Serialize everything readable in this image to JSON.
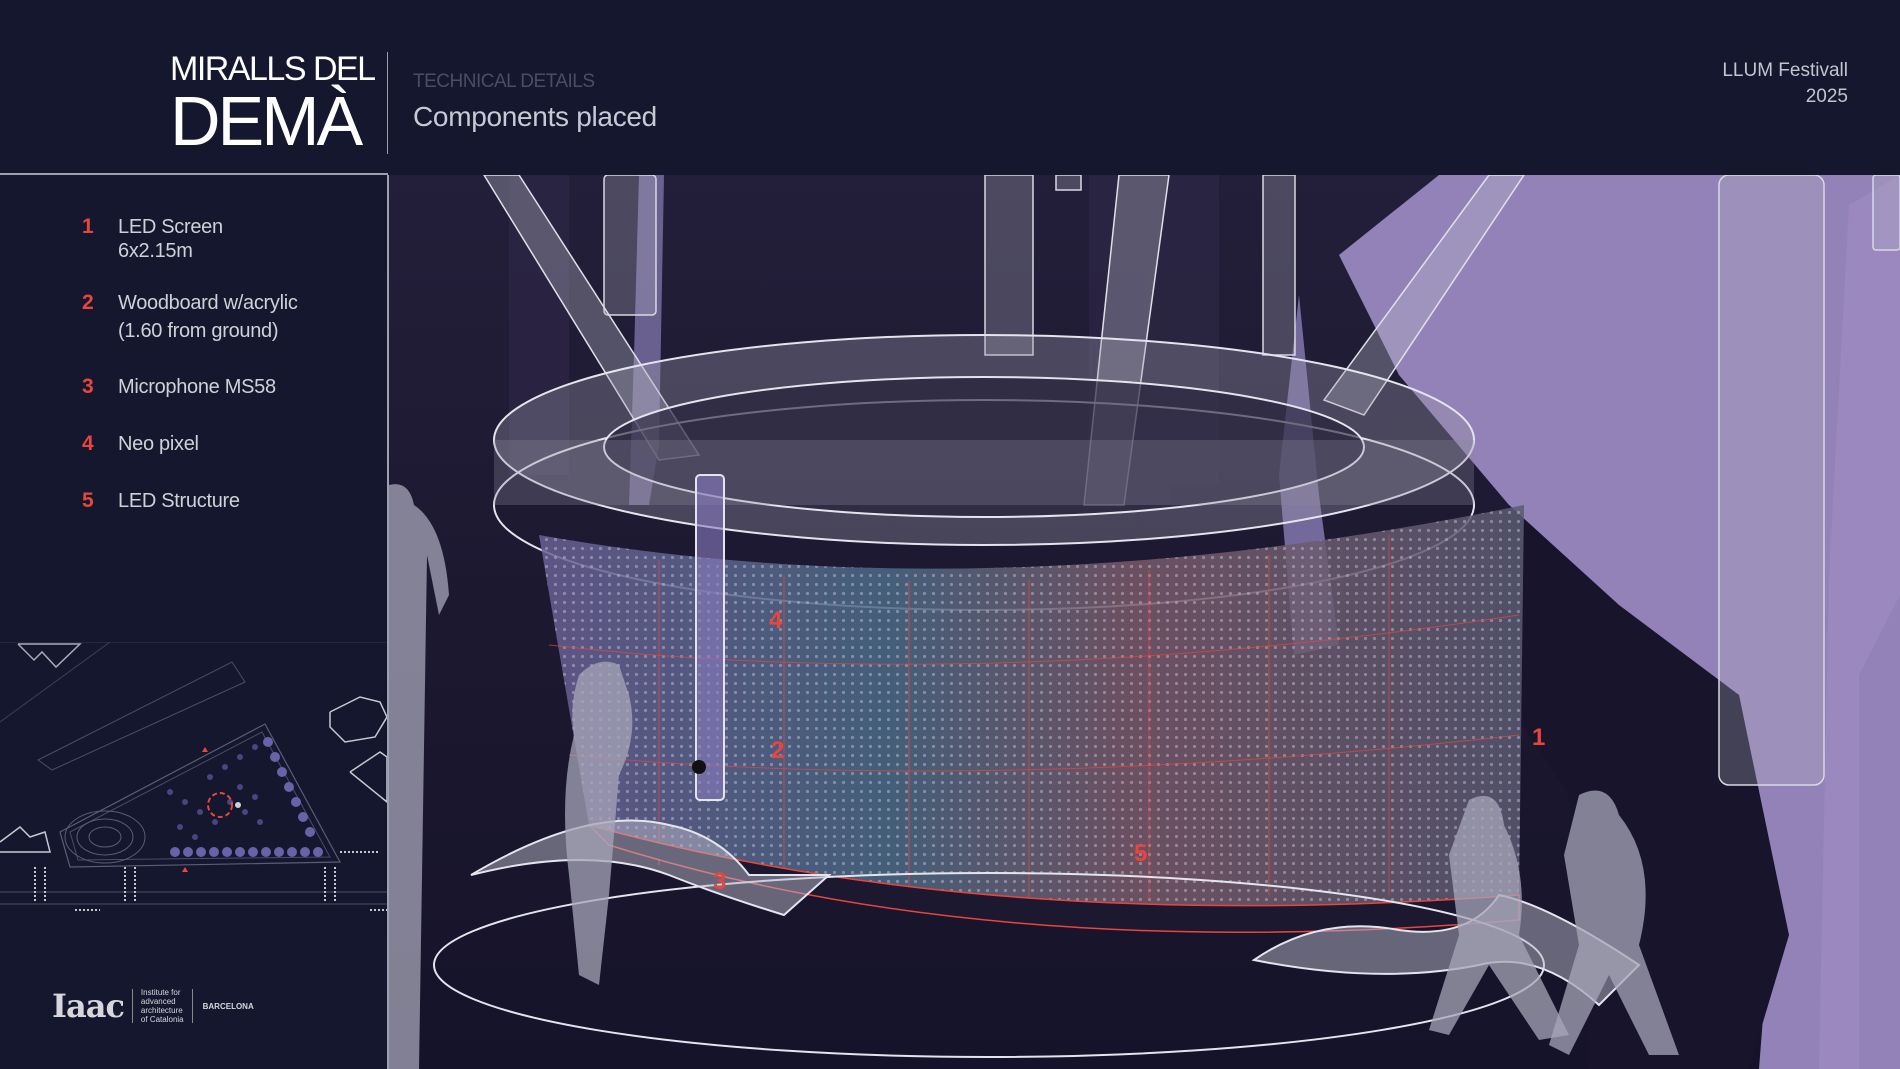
{
  "header": {
    "brand_line1": "MIRALLS DEL",
    "brand_line2": "DEMÀ",
    "subtitle": "TECHNICAL DETAILS",
    "title": "Components placed",
    "festival_name": "LLUM Festivall",
    "festival_year": "2025"
  },
  "legend": {
    "items": [
      {
        "num": "1",
        "label": "LED Screen",
        "label2": "6x2.15m"
      },
      {
        "num": "2",
        "label": "Woodboard w/acrylic",
        "label2": "(1.60 from ground)"
      },
      {
        "num": "3",
        "label": "Microphone MS58",
        "label2": ""
      },
      {
        "num": "4",
        "label": "Neo pixel",
        "label2": ""
      },
      {
        "num": "5",
        "label": "LED Structure",
        "label2": ""
      }
    ]
  },
  "scene": {
    "callouts": [
      "1",
      "2",
      "3",
      "4",
      "5"
    ]
  },
  "logo": {
    "mark": "Iaac",
    "institute_line1": "Institute for",
    "institute_line2": "advanced",
    "institute_line3": "architecture",
    "institute_line4": "of Catalonia",
    "city": "BARCELONA"
  },
  "colors": {
    "background": "#14172e",
    "accent": "#e8463d",
    "tree_lilac": "#9a88bf"
  }
}
